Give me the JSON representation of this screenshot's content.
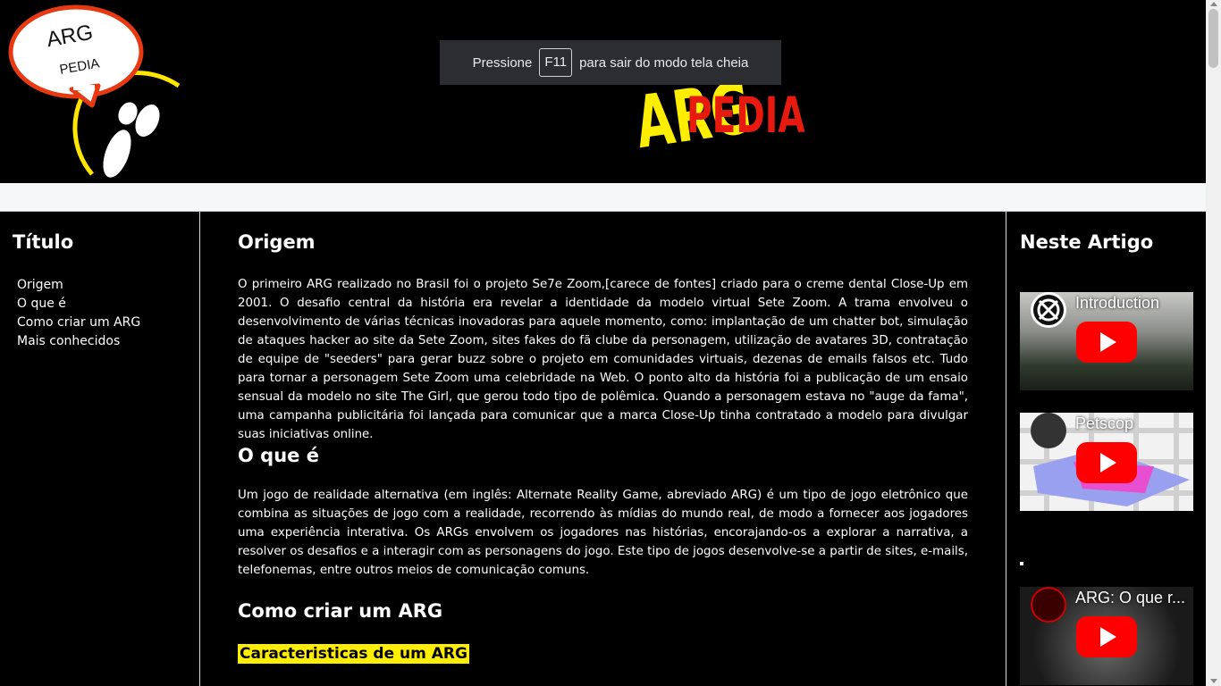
{
  "logo": {
    "line1": "ARG",
    "line2": "PEDIA"
  },
  "fullscreen_notice": {
    "before": "Pressione",
    "key": "F11",
    "after": "para sair do modo tela cheia"
  },
  "sidebar_left": {
    "title": "Título",
    "items": [
      "Origem",
      "O que é",
      "Como criar um ARG",
      "Mais conhecidos"
    ]
  },
  "main": {
    "sections": [
      {
        "heading": "Origem",
        "text": "O primeiro ARG realizado no Brasil foi o projeto Se7e Zoom,[carece de fontes] criado para o creme dental Close-Up em 2001. O desafio central da história era revelar a identidade da modelo virtual Sete Zoom. A trama envolveu o desenvolvimento de várias técnicas inovadoras para aquele momento, como: implantação de um chatter bot, simulação de ataques hacker ao site da Sete Zoom, sites fakes do fã clube da personagem, utilização de avatares 3D, contratação de equipe de \"seeders\" para gerar buzz sobre o projeto em comunidades virtuais, dezenas de emails falsos etc. Tudo para tornar a personagem Sete Zoom uma celebridade na Web. O ponto alto da história foi a publicação de um ensaio sensual da modelo no site The Girl, que gerou todo tipo de polêmica. Quando a personagem estava no \"auge da fama\", uma campanha publicitária foi lançada para comunicar que a marca Close-Up tinha contratado a modelo para divulgar suas iniciativas online."
      },
      {
        "heading": "O que é",
        "text": "Um jogo de realidade alternativa (em inglês: Alternate Reality Game, abreviado ARG) é um tipo de jogo eletrônico que combina as situações de jogo com a realidade, recorrendo às mídias do mundo real, de modo a fornecer aos jogadores uma experiência interativa. Os ARGs envolvem os jogadores nas histórias, encorajando-os a explorar a narrativa, a resolver os desafios e a interagir com as personagens do jogo. Este tipo de jogos desenvolve-se a partir de sites, e-mails, telefonemas, entre outros meios de comunicação comuns."
      },
      {
        "heading": "Como criar um ARG"
      }
    ],
    "highlight": "Caracteristicas de um ARG"
  },
  "sidebar_right": {
    "title": "Neste Artigo",
    "videos": [
      {
        "title": "Introduction",
        "channel_icon": "crossed-circle-icon"
      },
      {
        "title": "Petscop",
        "channel_icon": "dark-avatar-icon"
      },
      {
        "title": "ARG: O que r...",
        "channel_icon": "red-logo-icon"
      }
    ]
  },
  "colors": {
    "accent_yellow": "#ffee00",
    "accent_red": "#e82c10",
    "youtube_red": "#ff0000"
  }
}
